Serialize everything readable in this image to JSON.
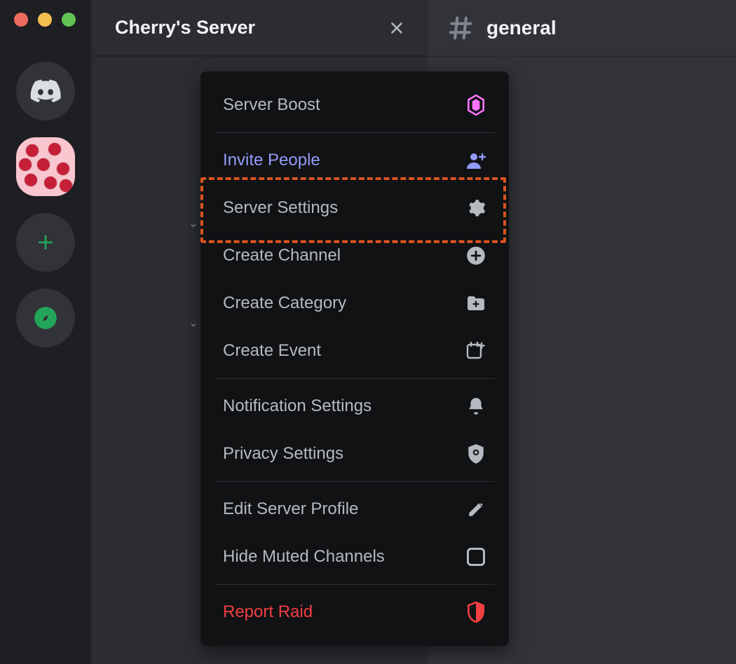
{
  "server_header": {
    "title": "Cherry's Server"
  },
  "channel": {
    "name": "general"
  },
  "dropdown": {
    "items": [
      {
        "label": "Server Boost",
        "icon": "boost-icon",
        "variant": "default"
      },
      {
        "label": "Invite People",
        "icon": "invite-icon",
        "variant": "invite"
      },
      {
        "label": "Server Settings",
        "icon": "gear-icon",
        "variant": "default",
        "highlighted": true
      },
      {
        "label": "Create Channel",
        "icon": "plus-circle-icon",
        "variant": "default"
      },
      {
        "label": "Create Category",
        "icon": "folder-plus-icon",
        "variant": "default"
      },
      {
        "label": "Create Event",
        "icon": "calendar-plus-icon",
        "variant": "default"
      },
      {
        "label": "Notification Settings",
        "icon": "bell-icon",
        "variant": "default"
      },
      {
        "label": "Privacy Settings",
        "icon": "shield-star-icon",
        "variant": "default"
      },
      {
        "label": "Edit Server Profile",
        "icon": "pencil-icon",
        "variant": "default"
      },
      {
        "label": "Hide Muted Channels",
        "icon": "checkbox-icon",
        "variant": "default"
      },
      {
        "label": "Report Raid",
        "icon": "shield-alert-icon",
        "variant": "report"
      }
    ]
  },
  "colors": {
    "accent_invite": "#949cf7",
    "accent_danger": "#f23f42",
    "highlight_border": "#d9531e",
    "boost_pink": "#ff73fa"
  }
}
